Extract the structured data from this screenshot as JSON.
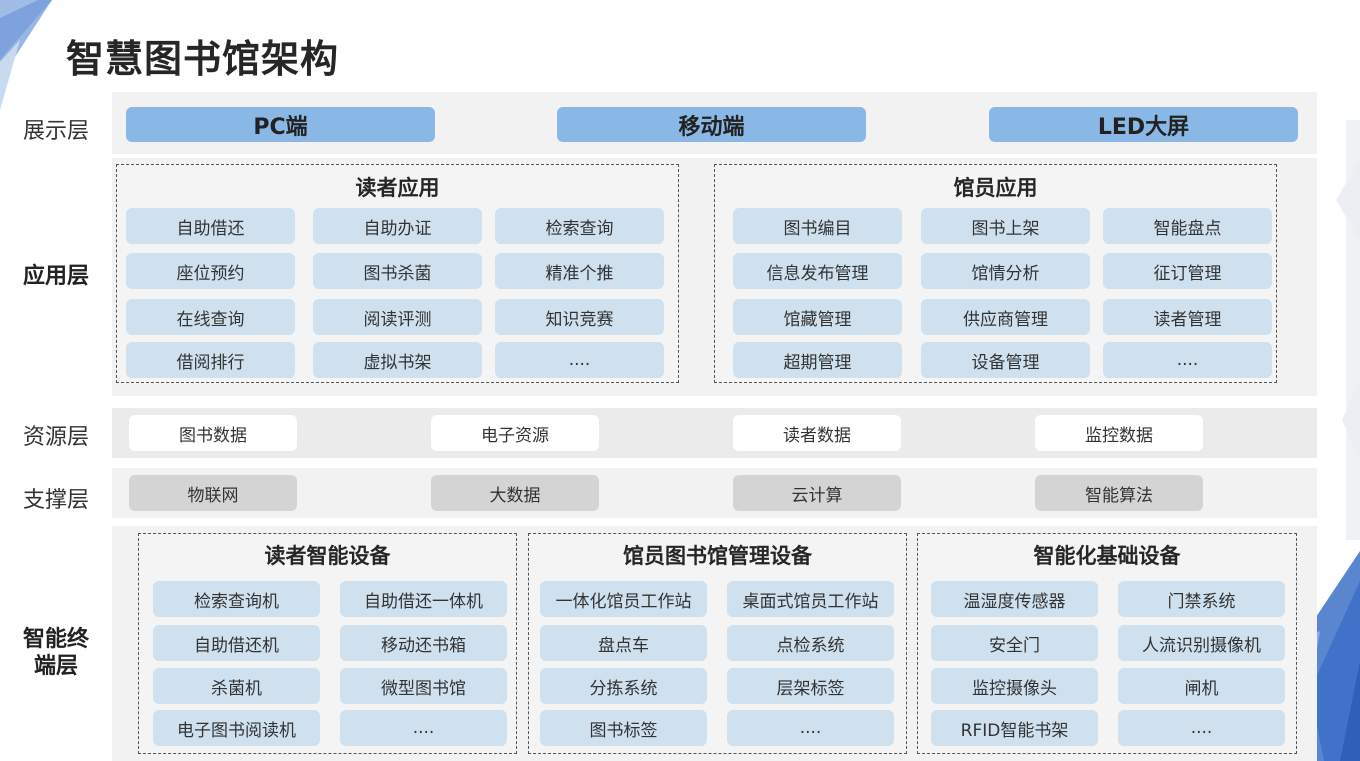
{
  "title": "智慧图书馆架构",
  "layers": {
    "display": {
      "label": "展示层",
      "items": [
        "PC端",
        "移动端",
        "LED大屏"
      ]
    },
    "application": {
      "label": "应用层",
      "groups": [
        {
          "title": "读者应用",
          "items": [
            "自助借还",
            "自助办证",
            "检索查询",
            "座位预约",
            "图书杀菌",
            "精准个推",
            "在线查询",
            "阅读评测",
            "知识竞赛",
            "借阅排行",
            "虚拟书架",
            "...."
          ]
        },
        {
          "title": "馆员应用",
          "items": [
            "图书编目",
            "图书上架",
            "智能盘点",
            "信息发布管理",
            "馆情分析",
            "征订管理",
            "馆藏管理",
            "供应商管理",
            "读者管理",
            "超期管理",
            "设备管理",
            "...."
          ]
        }
      ]
    },
    "resource": {
      "label": "资源层",
      "items": [
        "图书数据",
        "电子资源",
        "读者数据",
        "监控数据"
      ]
    },
    "support": {
      "label": "支撑层",
      "items": [
        "物联网",
        "大数据",
        "云计算",
        "智能算法"
      ]
    },
    "terminal": {
      "label_line1": "智能终",
      "label_line2": "端层",
      "groups": [
        {
          "title": "读者智能设备",
          "items": [
            "检索查询机",
            "自助借还一体机",
            "自助借还机",
            "移动还书箱",
            "杀菌机",
            "微型图书馆",
            "电子图书阅读机",
            "...."
          ]
        },
        {
          "title": "馆员图书馆管理设备",
          "items": [
            "一体化馆员工作站",
            "桌面式馆员工作站",
            "盘点车",
            "点检系统",
            "分拣系统",
            "层架标签",
            "图书标签",
            "...."
          ]
        },
        {
          "title": "智能化基础设备",
          "items": [
            "温湿度传感器",
            "门禁系统",
            "安全门",
            "人流识别摄像机",
            "监控摄像头",
            "闸机",
            "RFID智能书架",
            "...."
          ]
        }
      ]
    }
  },
  "colors": {
    "display_pill": "#8ab8e6",
    "cell": "#cfe1ef",
    "support_pill": "#d4d4d4",
    "band": "#f2f2f2",
    "accent_decoration": "#3f72c8"
  }
}
